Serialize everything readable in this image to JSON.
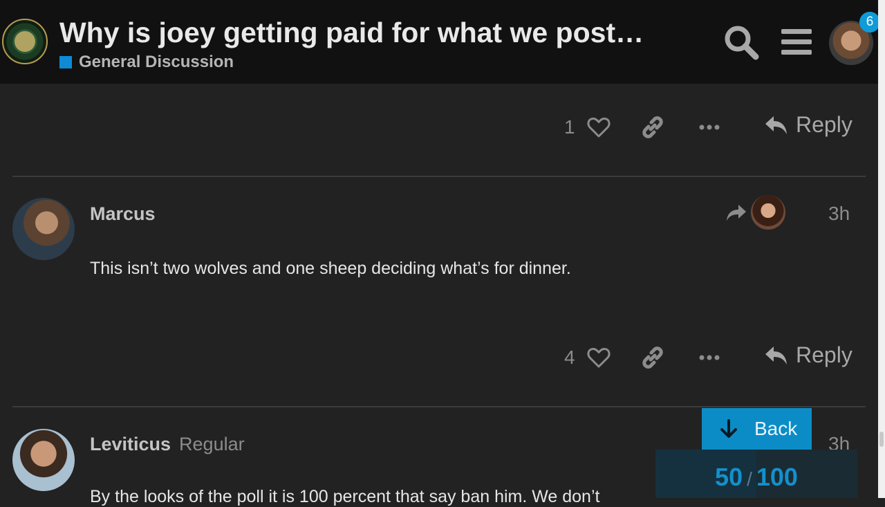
{
  "header": {
    "title": "Why is joey getting paid for what we post…",
    "category": "General Discussion",
    "category_color": "#0e8ad6",
    "notification_count": "6"
  },
  "posts": [
    {
      "actions": {
        "likes": "1",
        "reply_label": "Reply"
      }
    },
    {
      "username": "Marcus",
      "time": "3h",
      "body": "This isn’t two wolves and one sheep deciding what’s for dinner.",
      "actions": {
        "likes": "4",
        "reply_label": "Reply"
      }
    },
    {
      "username": "Leviticus",
      "user_title": "Regular",
      "time": "3h",
      "body": "By the looks of the poll it is 100 percent that say ban him. We don’t"
    }
  ],
  "timeline": {
    "back_label": "Back",
    "current": "50",
    "separator": "/",
    "total": "100",
    "progress": 0.5
  },
  "colors": {
    "accent": "#0c8cc6",
    "background": "#222222",
    "header": "#111111"
  }
}
